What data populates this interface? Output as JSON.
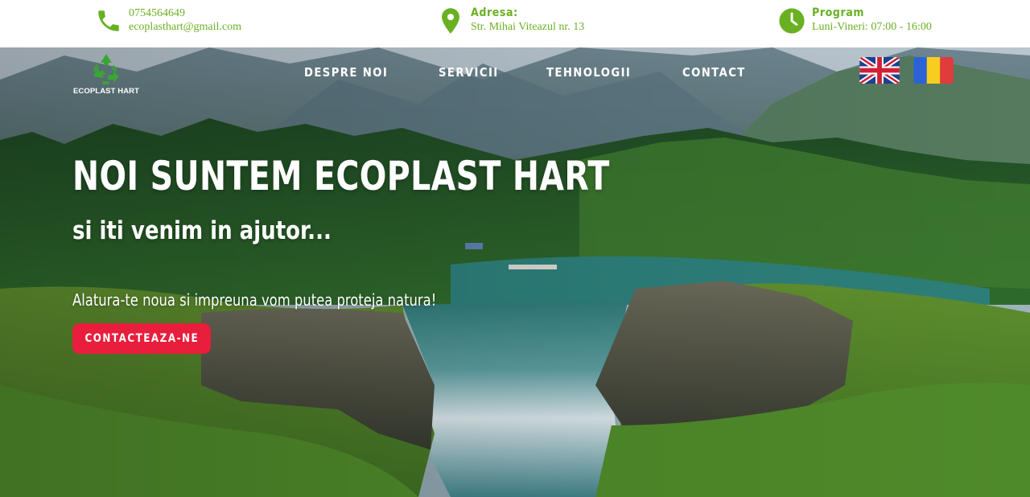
{
  "topbar": {
    "phone": {
      "icon": "phone-icon",
      "number": "0754564649",
      "email": "ecoplasthart@gmail.com"
    },
    "address": {
      "icon": "map-pin-icon",
      "label": "Adresa:",
      "value": "Str. Mihai Viteazul nr. 13"
    },
    "program": {
      "icon": "clock-icon",
      "label": "Program",
      "value": "Luni-Vineri: 07:00 - 16:00"
    }
  },
  "header": {
    "logo": {
      "icon": "recycle-icon",
      "name": "ECOPLAST HART"
    },
    "nav": [
      "DESPRE NOI",
      "SERVICII",
      "TEHNOLOGII",
      "CONTACT"
    ],
    "languages": [
      {
        "icon": "uk-flag-icon",
        "code": "en"
      },
      {
        "icon": "romania-flag-icon",
        "code": "ro"
      }
    ]
  },
  "hero": {
    "headline": "NOI SUNTEM ECOPLAST HART",
    "subheadline": "si iti venim in ajutor...",
    "tagline": "Alatura-te noua si impreuna vom putea proteja natura!",
    "cta_label": "CONTACTEAZA-NE"
  },
  "colors": {
    "accent_green": "#6ab023",
    "cta_red": "#e81e3c",
    "text_white": "#ffffff"
  }
}
